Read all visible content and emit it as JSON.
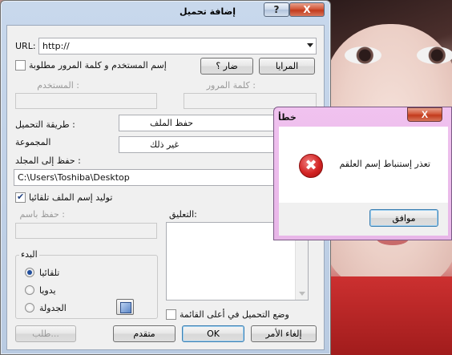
{
  "main_dialog": {
    "title": "إضافة تحميل",
    "help_label": "?",
    "close_label": "X",
    "url_label": "URL:",
    "url_value": "http://",
    "auth_checkbox_label": "إسم المستخدم و كلمة المرور مطلوبة",
    "auth_checked": false,
    "mirrors_button": "المرايا",
    "paste_button": "ضار ؟",
    "username_label": "المستخدم :",
    "password_label": "كلمة المرور :",
    "download_method_label": "طريقة التحميل :",
    "download_method_value": "حفظ الملف",
    "group_label": "المجموعة",
    "group_value": "غير ذلك",
    "save_to_label": "حفظ إلى المجلد :",
    "save_to_value": "C:\\Users\\Toshiba\\Desktop",
    "autoname_label": "توليد إسم الملف تلقائيا",
    "autoname_checked": true,
    "save_as_label": "حفظ باسم :",
    "comment_label": "التعليق:",
    "start_group_title": "البدء",
    "start_options": [
      {
        "label": "تلقائيا",
        "selected": true
      },
      {
        "label": "يدويا",
        "selected": false
      },
      {
        "label": "الجدولة",
        "selected": false
      }
    ],
    "top_of_queue_label": "وضع التحميل في أعلى القائمة",
    "top_of_queue_checked": false,
    "buttons": {
      "login": "طلب...",
      "advanced": "متقدم",
      "ok": "OK",
      "cancel": "إلغاء الأمر"
    }
  },
  "error_dialog": {
    "title": "خطأ",
    "close_label": "X",
    "icon": "error-x-icon",
    "icon_glyph": "✖",
    "message": "تعذر إستنباط إسم العلقم",
    "ok_button": "موافق"
  },
  "colors": {
    "title_bar": "#c8d8ec",
    "error_frame": "#f0c2ef",
    "close_red": "#c23a1c"
  }
}
